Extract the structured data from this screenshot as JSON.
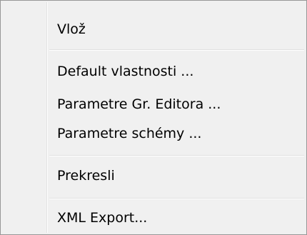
{
  "menu": {
    "items": [
      {
        "label": "Vlož"
      },
      {
        "label": "Default vlastnosti ..."
      },
      {
        "label": "Parametre Gr. Editora ..."
      },
      {
        "label": "Parametre schémy ..."
      },
      {
        "label": "Prekresli"
      },
      {
        "label": "XML Export..."
      }
    ]
  }
}
